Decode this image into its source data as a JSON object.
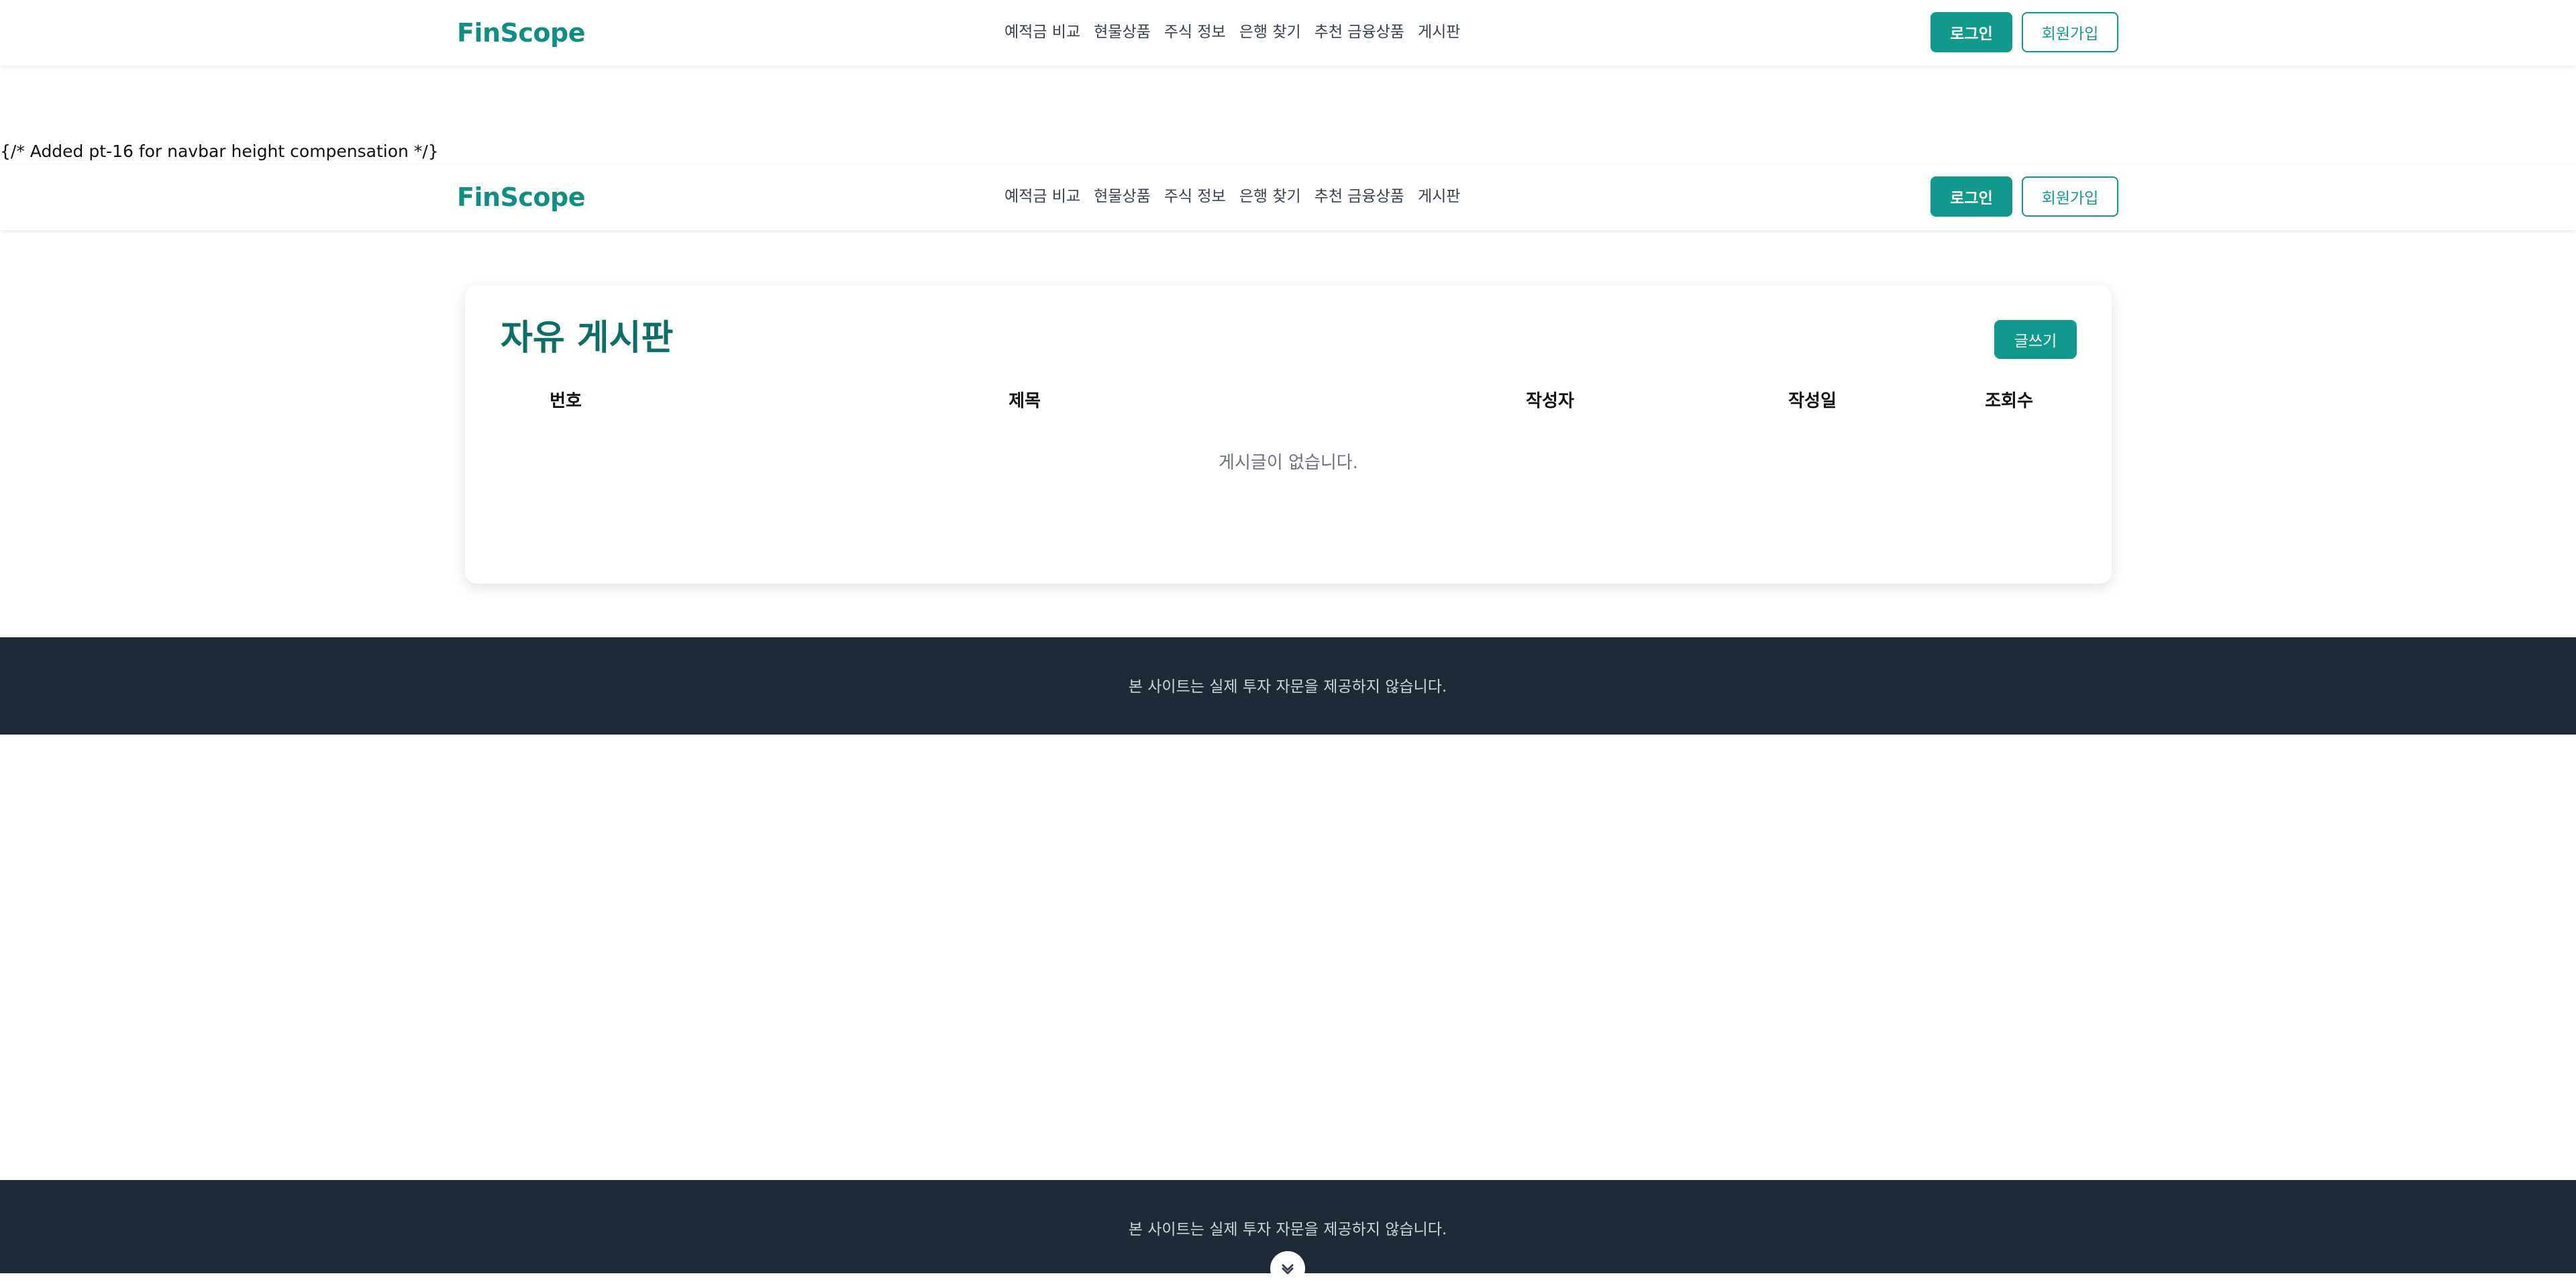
{
  "navbar": {
    "brand": "FinScope",
    "links": [
      "예적금 비교",
      "현물상품",
      "주식 정보",
      "은행 찾기",
      "추천 금융상품",
      "게시판"
    ],
    "login_label": "로그인",
    "signup_label": "회원가입"
  },
  "stray_comment": "{/* Added pt-16 for navbar height compensation */}",
  "board": {
    "title": "자유 게시판",
    "write_label": "글쓰기",
    "columns": [
      "번호",
      "제목",
      "작성자",
      "작성일",
      "조회수"
    ],
    "empty_message": "게시글이 없습니다."
  },
  "footer": {
    "text": "본 사이트는 실제 투자 자문을 제공하지 않습니다."
  },
  "colors": {
    "brand": "#0f8f84",
    "accent": "#11998e",
    "footer_bg": "#1f2937"
  }
}
